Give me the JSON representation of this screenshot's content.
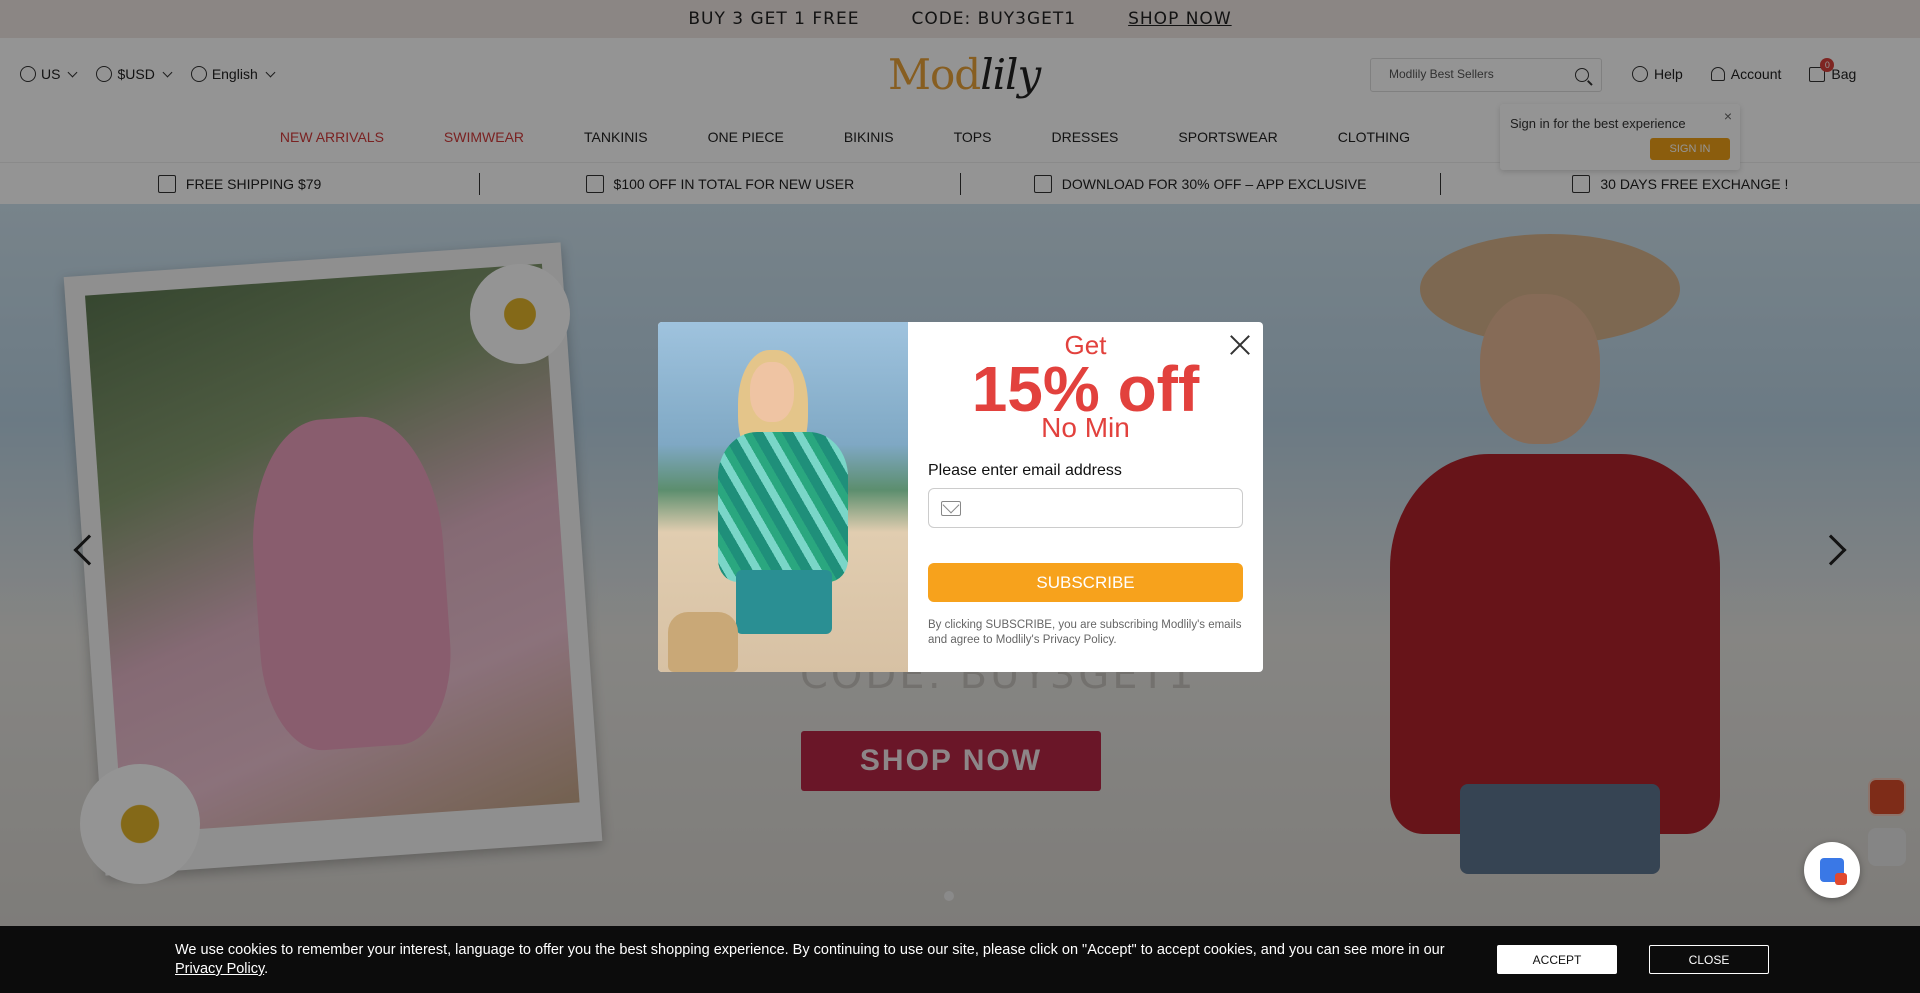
{
  "promo": {
    "offer": "BUY 3 GET 1 FREE",
    "code": "CODE: BUY3GET1",
    "shop_now": "SHOP NOW"
  },
  "header": {
    "locale": {
      "region": "US",
      "currency": "$USD",
      "language": "English"
    },
    "logo": {
      "mod": "Mod",
      "lily": "lily"
    },
    "search_placeholder": "Modlily Best Sellers",
    "links": {
      "help": "Help",
      "account": "Account",
      "bag": "Bag",
      "bag_count": "0"
    }
  },
  "nav": {
    "items": [
      {
        "label": "NEW ARRIVALS",
        "hot": true
      },
      {
        "label": "SWIMWEAR",
        "hot": true
      },
      {
        "label": "TANKINIS",
        "hot": false
      },
      {
        "label": "ONE PIECE",
        "hot": false
      },
      {
        "label": "BIKINIS",
        "hot": false
      },
      {
        "label": "TOPS",
        "hot": false
      },
      {
        "label": "DRESSES",
        "hot": false
      },
      {
        "label": "SPORTSWEAR",
        "hot": false
      },
      {
        "label": "CLOTHING",
        "hot": false
      }
    ]
  },
  "signin_tip": {
    "text": "Sign in for the best experience",
    "button": "SIGN IN",
    "close": "×"
  },
  "benefits": [
    {
      "text": "FREE SHIPPING $79",
      "icon": "shipping-icon"
    },
    {
      "text": "$100 OFF IN TOTAL FOR NEW USER",
      "icon": "coupon-icon"
    },
    {
      "text": "DOWNLOAD FOR 30% OFF – APP EXCLUSIVE",
      "icon": "phone-icon"
    },
    {
      "text": "30 DAYS FREE EXCHANGE !",
      "icon": "exchange-icon"
    }
  ],
  "hero": {
    "code": "CODE: BUY3GET1",
    "shop_now": "SHOP NOW"
  },
  "modal": {
    "get": "Get",
    "percent": "15% off",
    "no_min": "No Min",
    "email_label": "Please enter email address",
    "email_value": "",
    "subscribe": "SUBSCRIBE",
    "disclaimer": "By clicking SUBSCRIBE, you are subscribing Modlily's emails and agree to Modlily's Privacy Policy."
  },
  "cookie": {
    "text": "We use cookies to remember your interest, language to offer you the best shopping experience. By continuing to use our site, please click on \"Accept\" to accept cookies, and you can see more in our ",
    "link": "Privacy Policy",
    "period": ".",
    "accept": "ACCEPT",
    "close": "CLOSE"
  },
  "colors": {
    "accent_orange": "#f7a21c",
    "promo_red": "#e2413d",
    "hot_nav": "#d23b3b",
    "shop_button": "#b72646"
  }
}
